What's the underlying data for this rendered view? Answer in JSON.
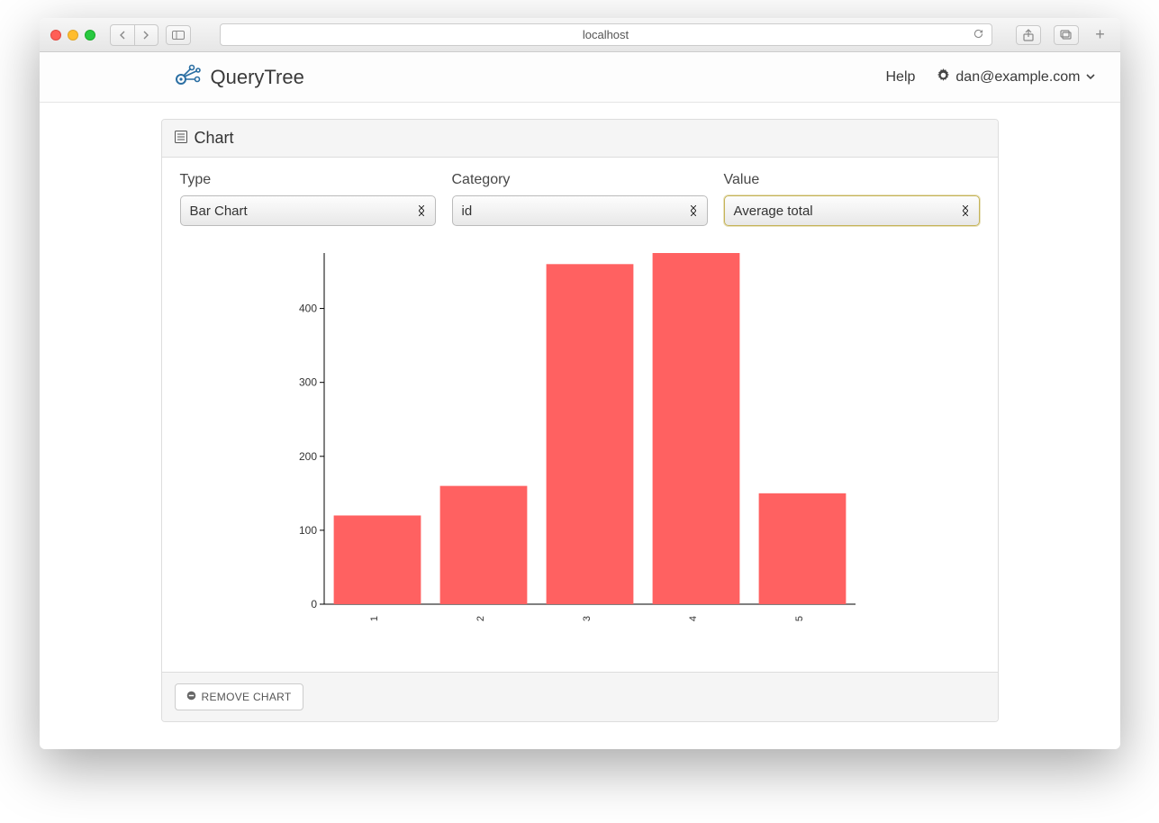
{
  "browser": {
    "url": "localhost"
  },
  "header": {
    "brand": "QueryTree",
    "help": "Help",
    "user_email": "dan@example.com"
  },
  "panel": {
    "title": "Chart",
    "labels": {
      "type": "Type",
      "category": "Category",
      "value": "Value"
    },
    "selects": {
      "type": "Bar Chart",
      "category": "id",
      "value": "Average total"
    },
    "remove_button": "REMOVE CHART"
  },
  "chart_data": {
    "type": "bar",
    "categories": [
      "1",
      "2",
      "3",
      "4",
      "5"
    ],
    "values": [
      120,
      160,
      460,
      475,
      150
    ],
    "ylim": [
      0,
      475
    ],
    "yticks": [
      0,
      100,
      200,
      300,
      400
    ],
    "bar_color": "#ff6161"
  }
}
